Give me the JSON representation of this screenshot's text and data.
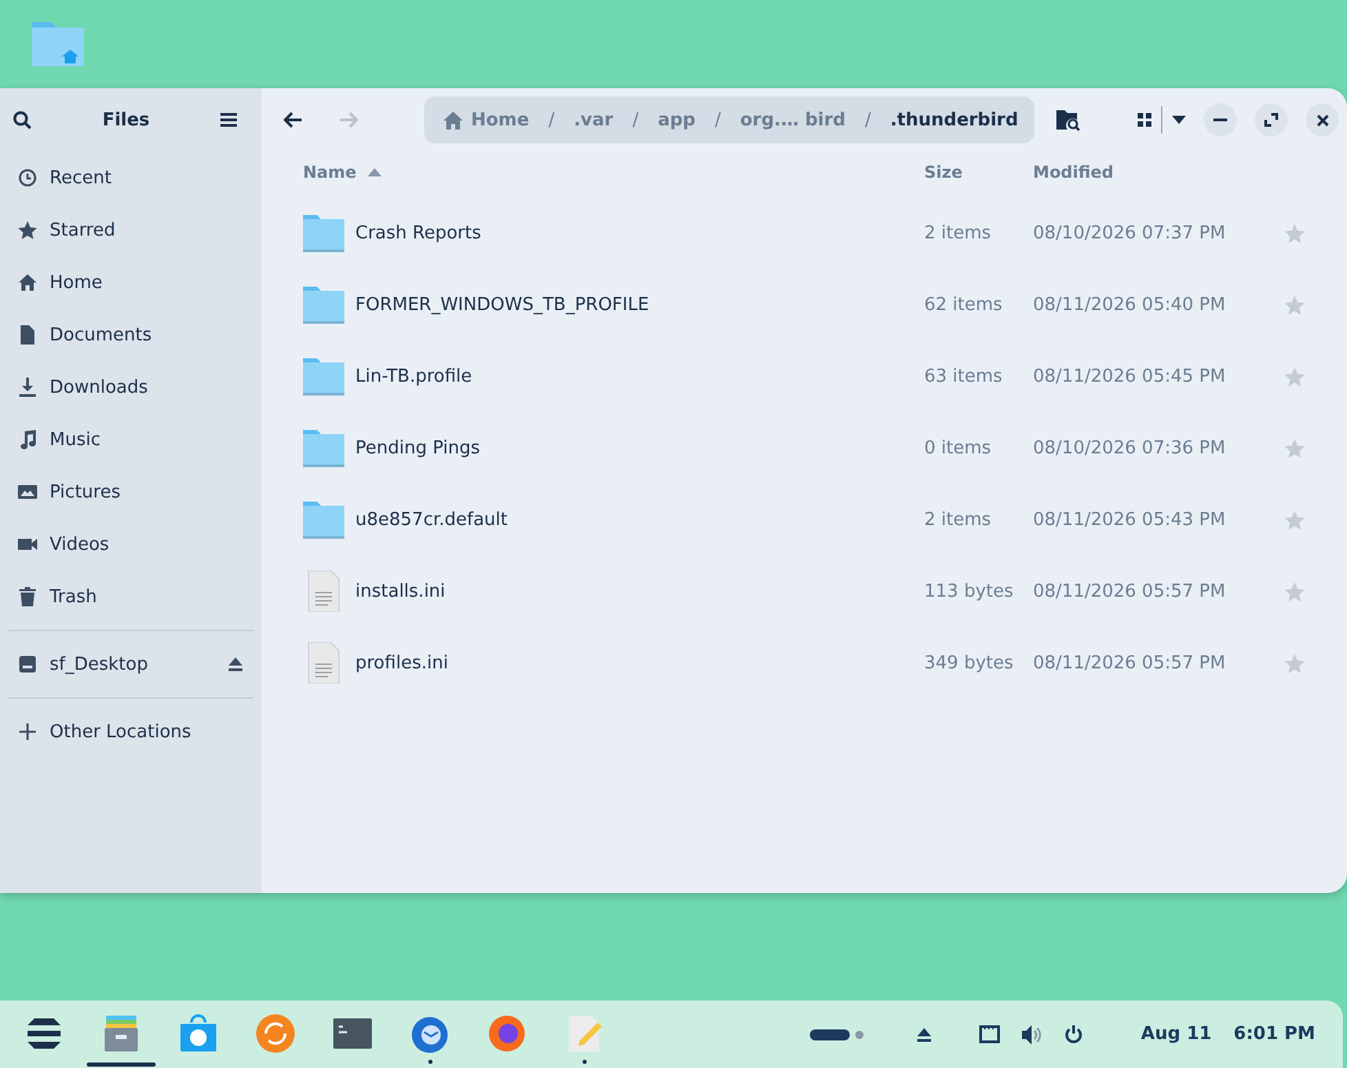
{
  "sidebar": {
    "title": "Files",
    "places": [
      {
        "label": "Recent",
        "kind": "recent"
      },
      {
        "label": "Starred",
        "kind": "starred"
      },
      {
        "label": "Home",
        "kind": "home"
      },
      {
        "label": "Documents",
        "kind": "documents"
      },
      {
        "label": "Downloads",
        "kind": "downloads"
      },
      {
        "label": "Music",
        "kind": "music"
      },
      {
        "label": "Pictures",
        "kind": "pictures"
      },
      {
        "label": "Videos",
        "kind": "videos"
      },
      {
        "label": "Trash",
        "kind": "trash"
      }
    ],
    "devices": [
      {
        "label": "sf_Desktop",
        "kind": "drive"
      }
    ],
    "other": [
      {
        "label": "Other Locations",
        "kind": "other"
      }
    ]
  },
  "toolbar": {
    "forward_disabled": true,
    "path": [
      {
        "label": "Home",
        "kind": "home",
        "current": false,
        "separator": "/"
      },
      {
        "label": ".var",
        "kind": "folder",
        "current": false,
        "separator": "/"
      },
      {
        "label": "app",
        "kind": "folder",
        "current": false,
        "separator": "/"
      },
      {
        "label": "org.… bird",
        "kind": "folder",
        "current": false,
        "separator": "/"
      },
      {
        "label": ".thunderbird",
        "kind": "folder",
        "current": true
      }
    ]
  },
  "columns": [
    {
      "label": "Name",
      "sorted": true
    },
    {
      "label": "Size",
      "sorted": false
    },
    {
      "label": "Modified",
      "sorted": false
    }
  ],
  "files": [
    {
      "name": "Crash Reports",
      "kind": "folder",
      "size": "2 items",
      "modified": "08/10/2026 07:37 PM",
      "starred": false
    },
    {
      "name": "FORMER_WINDOWS_TB_PROFILE",
      "kind": "folder",
      "size": "62 items",
      "modified": "08/11/2026 05:40 PM",
      "starred": false
    },
    {
      "name": "Lin-TB.profile",
      "kind": "folder",
      "size": "63 items",
      "modified": "08/11/2026 05:45 PM",
      "starred": false
    },
    {
      "name": "Pending Pings",
      "kind": "folder",
      "size": "0 items",
      "modified": "08/10/2026 07:36 PM",
      "starred": false
    },
    {
      "name": "u8e857cr.default",
      "kind": "folder",
      "size": "2 items",
      "modified": "08/11/2026 05:43 PM",
      "starred": false
    },
    {
      "name": "installs.ini",
      "kind": "text",
      "size": "113 bytes",
      "modified": "08/11/2026 05:57 PM",
      "starred": false
    },
    {
      "name": "profiles.ini",
      "kind": "text",
      "size": "349 bytes",
      "modified": "08/11/2026 05:57 PM",
      "starred": false
    }
  ],
  "taskbar": {
    "apps": [
      {
        "kind": "launcher",
        "focused": false,
        "running": false
      },
      {
        "kind": "files",
        "focused": true,
        "running": false
      },
      {
        "kind": "store",
        "focused": false,
        "running": false
      },
      {
        "kind": "update",
        "focused": false,
        "running": false
      },
      {
        "kind": "terminal",
        "focused": false,
        "running": false
      },
      {
        "kind": "mail",
        "focused": false,
        "running": true
      },
      {
        "kind": "browser",
        "focused": false,
        "running": false
      },
      {
        "kind": "editor",
        "focused": false,
        "running": true
      }
    ],
    "date": "Aug 11",
    "time": "6:01 PM"
  }
}
